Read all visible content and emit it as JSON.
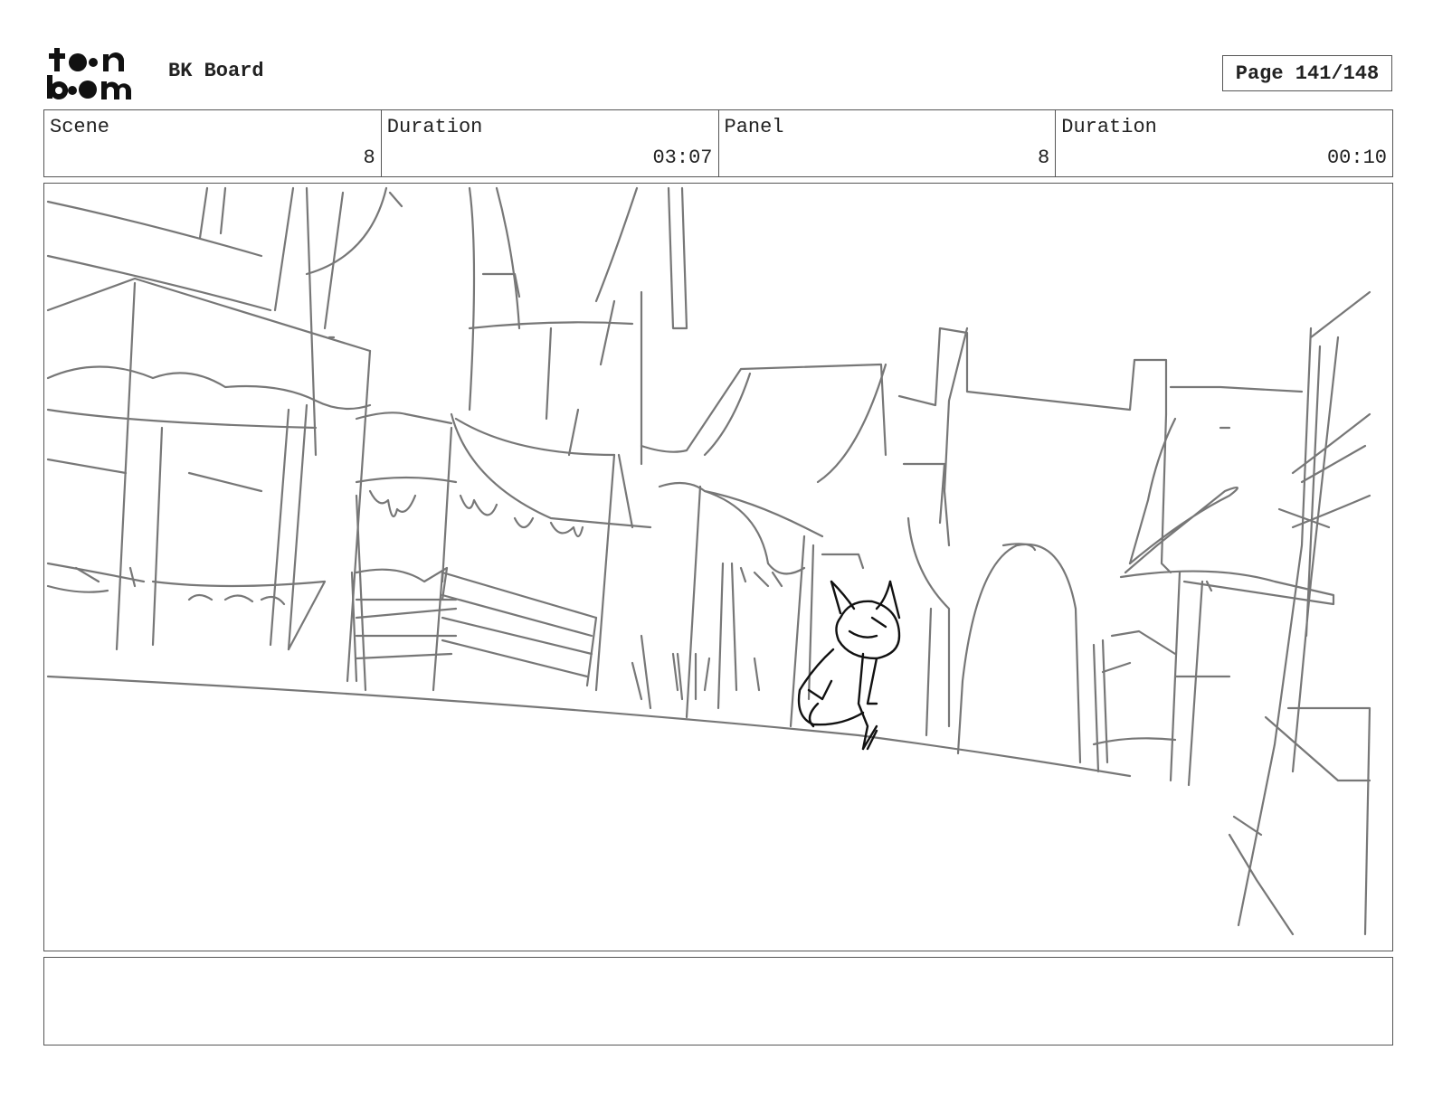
{
  "brand": {
    "logo_name": "toon boom"
  },
  "header": {
    "project_title": "BK Board",
    "page_label": "Page 141/148"
  },
  "info": {
    "scene_label": "Scene",
    "scene_value": "8",
    "scene_duration_label": "Duration",
    "scene_duration_value": "03:07",
    "panel_label": "Panel",
    "panel_value": "8",
    "panel_duration_label": "Duration",
    "panel_duration_value": "00:10"
  },
  "notes": {
    "text": ""
  },
  "colors": {
    "sketch": "#777777",
    "character": "#111111",
    "border": "#555555"
  }
}
